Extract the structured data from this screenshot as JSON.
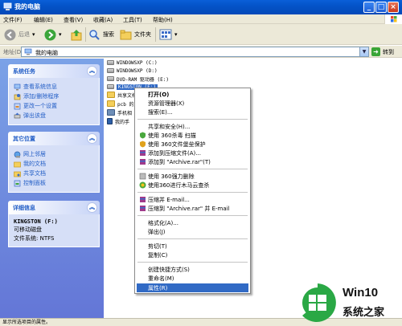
{
  "window": {
    "title": "我的电脑",
    "colors": {
      "titlebar": "#0453c8",
      "selection": "#316ac5",
      "task_pane": "#7ba2e7"
    }
  },
  "menubar": [
    "文件(F)",
    "编辑(E)",
    "查看(V)",
    "收藏(A)",
    "工具(T)",
    "帮助(H)"
  ],
  "toolbar": {
    "back": "后退",
    "search": "搜索",
    "folders": "文件夹"
  },
  "address": {
    "label": "地址(D)",
    "value": "我的电脑",
    "go": "转到"
  },
  "leftpane": {
    "system_tasks": {
      "title": "系统任务",
      "items": [
        "查看系统信息",
        "添加/删除程序",
        "更改一个设置",
        "弹出该盘"
      ]
    },
    "other_places": {
      "title": "其它位置",
      "items": [
        "网上邻居",
        "我的文档",
        "共享文档",
        "控制面板"
      ]
    },
    "details": {
      "title": "详细信息",
      "name": "KINGSTON (F:)",
      "type": "可移动磁盘",
      "fs": "文件系统: NTFS"
    }
  },
  "content": {
    "drives": [
      "WINDOWSXP (C:)",
      "WINDOWSXP (D:)",
      "DVD-RAM 驱动器 (E:)",
      "KINGSTON (F:)"
    ],
    "partial_items": [
      "共享文档",
      "pcb 的文",
      "手机相",
      "我的手"
    ]
  },
  "context_menu": {
    "items": [
      "打开(O)",
      "资源管理器(X)",
      "搜索(E)...",
      "共享和安全(H)...",
      "使用 360杀毒 扫描",
      "使用 360文件堡垒保护",
      "添加到压缩文件(A)...",
      "添加到 \"Archive.rar\"(T)",
      "使用 360强力删除",
      "使用360进行木马云查杀",
      "压缩并 E-mail...",
      "压缩到 \"Archive.rar\" 并 E-mail",
      "格式化(A)...",
      "弹出(J)",
      "剪切(T)",
      "复制(C)",
      "创建快捷方式(S)",
      "重命名(M)",
      "属性(R)"
    ]
  },
  "statusbar": {
    "text": "显示所选项目的属性。"
  },
  "watermark": {
    "title": "Win10",
    "subtitle": "系统之家"
  }
}
